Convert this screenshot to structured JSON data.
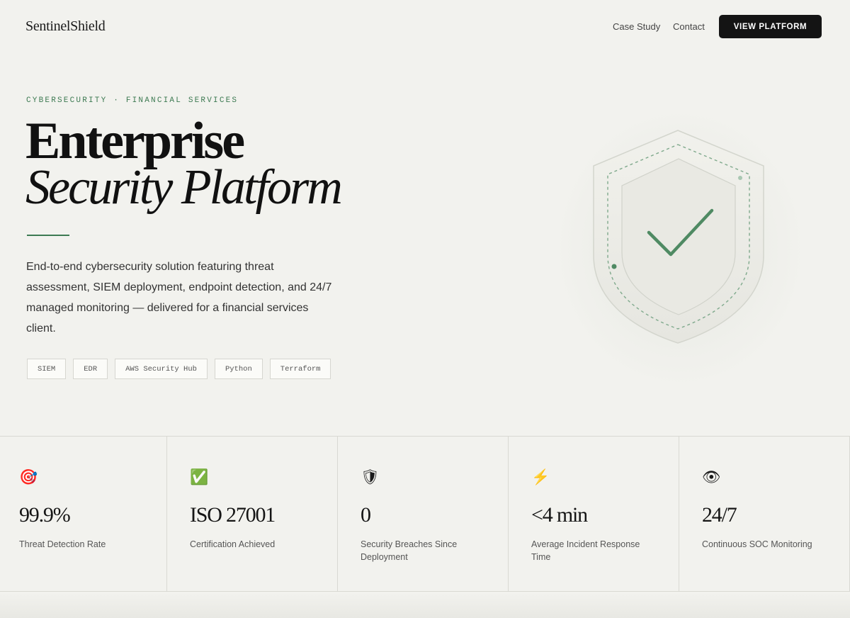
{
  "nav": {
    "brand": "SentinelShield",
    "links": [
      "Case Study",
      "Contact"
    ],
    "cta": "VIEW PLATFORM"
  },
  "hero": {
    "eyebrow": "CYBERSECURITY · FINANCIAL SERVICES",
    "title_line1": "Enterprise",
    "title_line2": "Security Platform",
    "description": "End-to-end cybersecurity solution featuring threat assessment, SIEM deployment, endpoint detection, and 24/7 managed monitoring — delivered for a financial services client.",
    "tags": [
      "SIEM",
      "EDR",
      "AWS Security Hub",
      "Python",
      "Terraform"
    ]
  },
  "colors": {
    "accent": "#3d7a52",
    "background": "#f2f2ee",
    "cta_bg": "#141414"
  },
  "stats": [
    {
      "icon": "🎯",
      "icon_name": "target-icon",
      "value": "99.9%",
      "label": "Threat Detection Rate"
    },
    {
      "icon": "✅",
      "icon_name": "check-mark-icon",
      "value": "ISO 27001",
      "label": "Certification Achieved"
    },
    {
      "icon": "🛡",
      "icon_name": "shield-icon",
      "value": "0",
      "label": "Security Breaches Since Deployment"
    },
    {
      "icon": "⚡",
      "icon_name": "lightning-icon",
      "value": "<4 min",
      "label": "Average Incident Response Time"
    },
    {
      "icon": "👁",
      "icon_name": "eye-icon",
      "value": "24/7",
      "label": "Continuous SOC Monitoring"
    }
  ]
}
